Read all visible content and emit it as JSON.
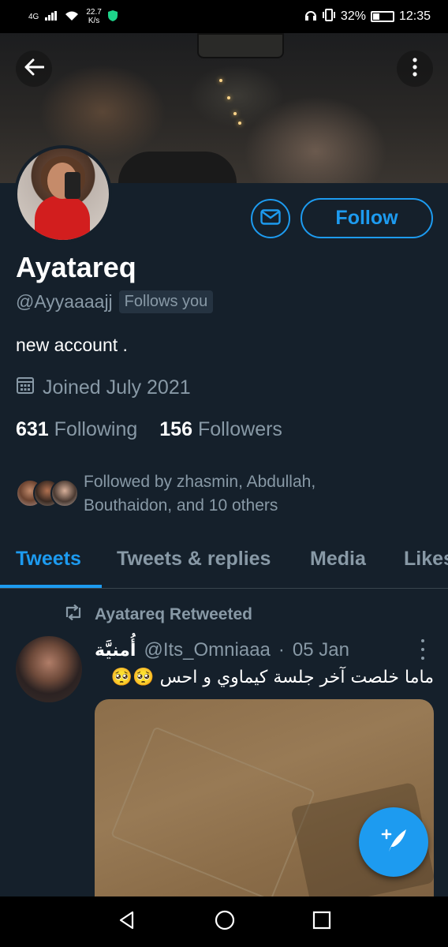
{
  "status_bar": {
    "network": "4G",
    "speed_value": "22.7",
    "speed_unit": "K/s",
    "battery": "32%",
    "battery_level": 0.32,
    "time": "12:35"
  },
  "profile": {
    "display_name": "Ayatareq",
    "handle": "@Ayyaaaajj",
    "follows_you": "Follows you",
    "bio": "new account .",
    "joined": "Joined July 2021",
    "following_count": "631",
    "following_label": "Following",
    "followers_count": "156",
    "followers_label": "Followers",
    "followed_by_line1": "Followed by zhasmin, Abdullah,",
    "followed_by_line2": "Bouthaidon, and 10 others",
    "follow_button": "Follow"
  },
  "tabs": [
    {
      "label": "Tweets",
      "active": true
    },
    {
      "label": "Tweets & replies",
      "active": false
    },
    {
      "label": "Media",
      "active": false
    },
    {
      "label": "Likes",
      "active": false
    }
  ],
  "tweet": {
    "retweet_label": "Ayatareq Retweeted",
    "author_name": "أُمنيَّة",
    "author_handle": "@Its_Omniaaa",
    "separator": "·",
    "date": "05 Jan",
    "text": "ماما خلصت آخر جلسة كيماوي و احس 🥺🥺"
  },
  "colors": {
    "background": "#15202b",
    "accent": "#1d9bf0",
    "secondary_text": "#8899a6"
  },
  "icons": {
    "back": "back-arrow-icon",
    "more": "more-vertical-icon",
    "message": "envelope-icon",
    "calendar": "calendar-icon",
    "retweet": "retweet-icon",
    "compose": "compose-tweet-icon"
  }
}
